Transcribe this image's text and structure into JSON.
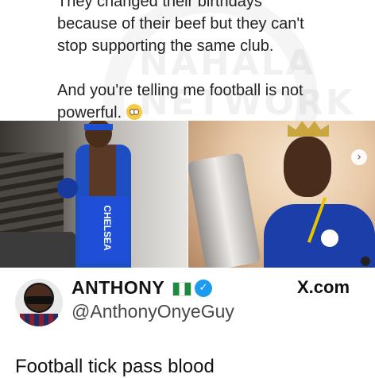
{
  "post": {
    "line1": "They changed their birthdays",
    "line2": "because of their beef but they can't",
    "line3": "stop supporting the same club.",
    "line4": "And you're telling me football is not",
    "line5": "powerful.",
    "emoji": "flushed-face-emoji"
  },
  "watermark": {
    "line1": "NAHALA",
    "line2": "NETWORK"
  },
  "photos": {
    "left": {
      "towel_text": "CHELSEA"
    },
    "right": {
      "next_symbol": "›"
    }
  },
  "author": {
    "name": "ANTHONY",
    "handle": "@AnthonyOnyeGuy",
    "verified_symbol": "✓",
    "site": "X.com"
  },
  "tweet": {
    "text": "Football tick pass blood"
  }
}
